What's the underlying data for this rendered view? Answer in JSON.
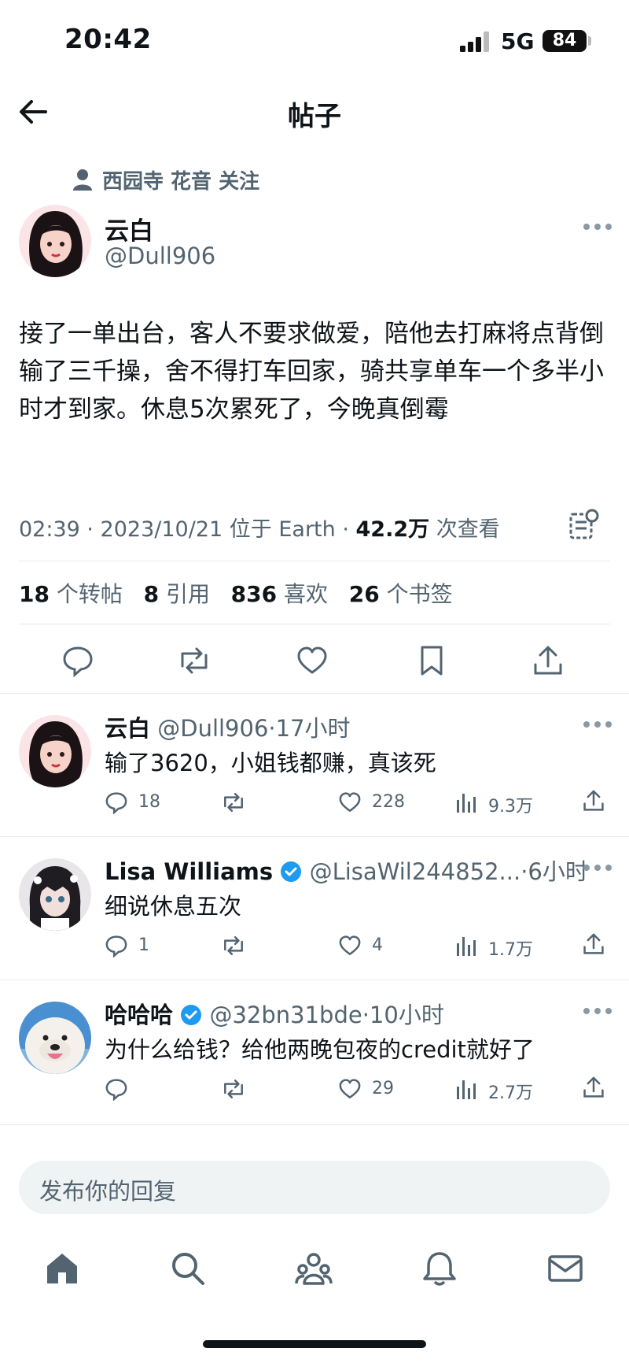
{
  "status_bar": {
    "time": "20:42",
    "network": "5G",
    "battery": "84"
  },
  "header": {
    "title": "帖子"
  },
  "social_context": {
    "text": "西园寺 花音 关注"
  },
  "post": {
    "name": "云白",
    "handle": "@Dull906",
    "text": "接了一单出台，客人不要求做爱，陪他去打麻将点背倒输了三千操，舍不得打车回家，骑共享单车一个多半小时才到家。休息5次累死了，今晚真倒霉",
    "timestamp": "02:39 · 2023/10/21 位于 Earth · ",
    "views": "42.2万",
    "views_label": " 次查看",
    "stats": {
      "reposts": "18",
      "reposts_label": " 个转帖",
      "quotes": "8",
      "quotes_label": " 引用",
      "likes": "836",
      "likes_label": " 喜欢",
      "bookmarks": "26",
      "bookmarks_label": " 个书签"
    }
  },
  "replies": [
    {
      "name": "云白",
      "verified": false,
      "handle": "@Dull906",
      "time": "·17小时",
      "text": "输了3620，小姐钱都赚，真该死",
      "replies": "18",
      "reposts": "",
      "likes": "228",
      "views": "9.3万"
    },
    {
      "name": "Lisa Williams",
      "verified": true,
      "handle": "@LisaWil244852...",
      "time": "·6小时",
      "text": "细说休息五次",
      "replies": "1",
      "reposts": "",
      "likes": "4",
      "views": "1.7万"
    },
    {
      "name": "哈哈哈",
      "verified": true,
      "handle": "@32bn31bde",
      "time": "·10小时",
      "text": "为什么给钱？给他两晚包夜的credit就好了",
      "replies": "",
      "reposts": "",
      "likes": "29",
      "views": "2.7万"
    }
  ],
  "composer": {
    "placeholder": "发布你的回复"
  },
  "colors": {
    "verified": "#1d9bf0",
    "text": "#0f1419",
    "secondary": "#536471",
    "divider": "#e6e9eb"
  },
  "icons": [
    "back-arrow-icon",
    "person-icon",
    "more-icon",
    "grok-icon",
    "reply-icon",
    "repost-icon",
    "like-icon",
    "bookmark-icon",
    "share-icon",
    "views-icon",
    "home-icon",
    "search-icon",
    "communities-icon",
    "notifications-icon",
    "messages-icon"
  ]
}
